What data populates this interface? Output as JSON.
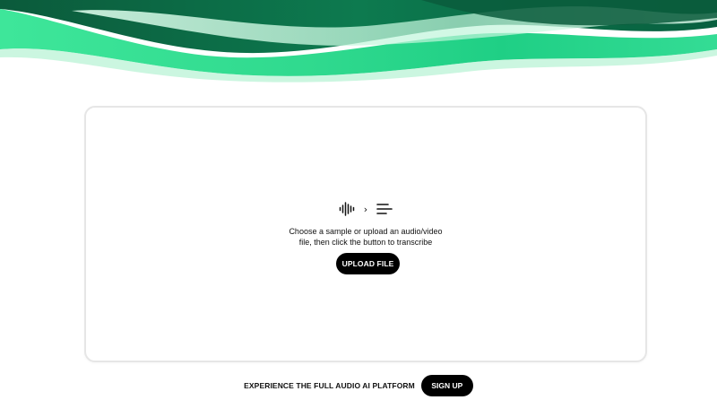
{
  "upload_panel": {
    "instruction_line1": "Choose a sample or upload an audio/video",
    "instruction_line2": "file, then click the button to transcribe",
    "upload_button_label": "UPLOAD FILE",
    "icons": [
      "audio-waveform-icon",
      "chevron-right-icon",
      "text-lines-icon"
    ]
  },
  "footer": {
    "promo_text": "EXPERIENCE THE FULL AUDIO AI PLATFORM",
    "signup_button_label": "SIGN UP"
  },
  "colors": {
    "background": "#ffffff",
    "brand_green": "#2fd98e",
    "dark_green": "#0a6b45",
    "button": "#000000",
    "button_text": "#ffffff"
  }
}
